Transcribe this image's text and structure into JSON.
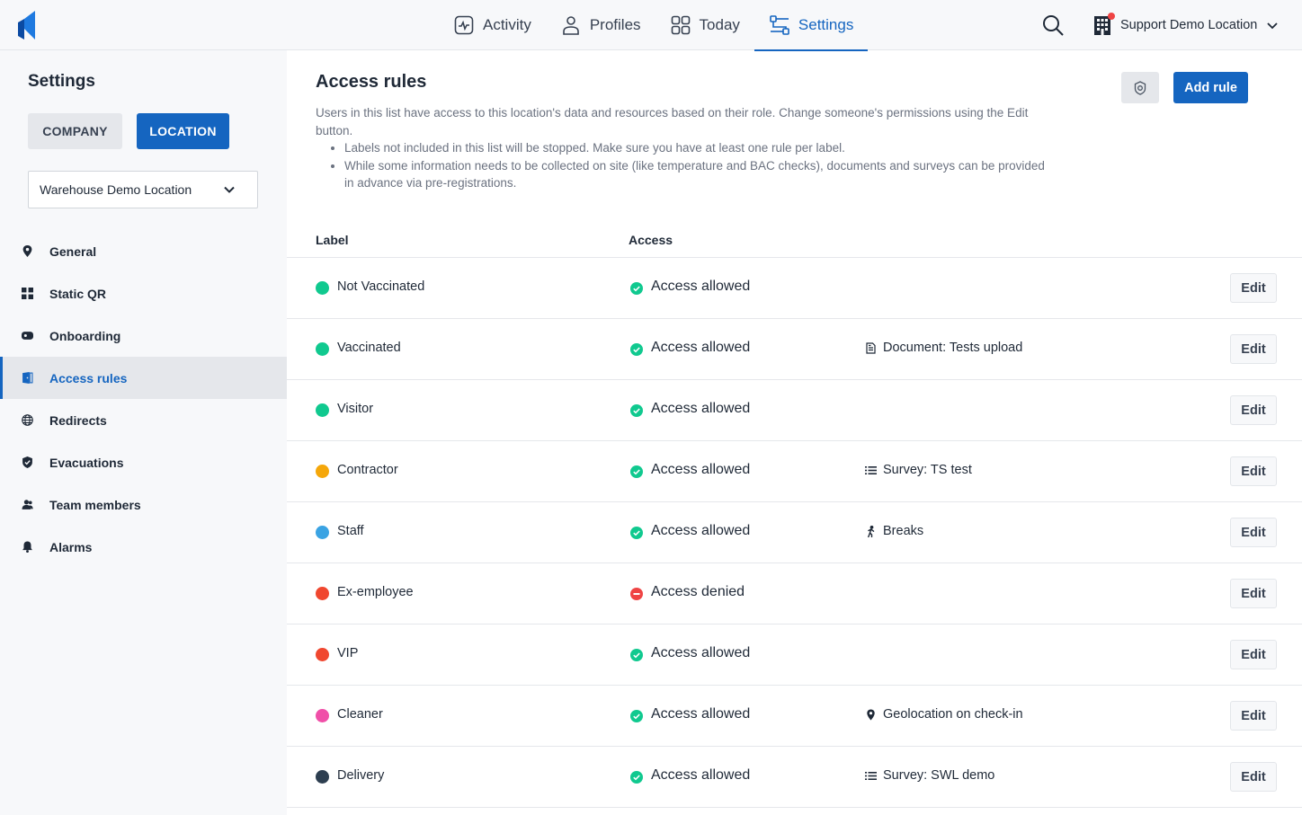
{
  "topbar": {
    "nav": [
      {
        "label": "Activity",
        "icon": "activity-icon",
        "active": false
      },
      {
        "label": "Profiles",
        "icon": "profile-icon",
        "active": false
      },
      {
        "label": "Today",
        "icon": "grid-icon",
        "active": false
      },
      {
        "label": "Settings",
        "icon": "settings-icon",
        "active": true
      }
    ],
    "location_name": "Support Demo Location",
    "accent": "#1565c0"
  },
  "sidebar": {
    "title": "Settings",
    "tabs": {
      "company": "COMPANY",
      "location": "LOCATION",
      "selected": "LOCATION"
    },
    "location_select": "Warehouse Demo Location",
    "items": [
      {
        "label": "General",
        "icon": "pin-icon",
        "active": false
      },
      {
        "label": "Static QR",
        "icon": "qr-icon",
        "active": false
      },
      {
        "label": "Onboarding",
        "icon": "onboarding-icon",
        "active": false
      },
      {
        "label": "Access rules",
        "icon": "door-icon",
        "active": true
      },
      {
        "label": "Redirects",
        "icon": "globe-icon",
        "active": false
      },
      {
        "label": "Evacuations",
        "icon": "shield-icon",
        "active": false
      },
      {
        "label": "Team members",
        "icon": "team-icon",
        "active": false
      },
      {
        "label": "Alarms",
        "icon": "bell-icon",
        "active": false
      }
    ]
  },
  "main": {
    "title": "Access rules",
    "add_button": "Add rule",
    "description": "Users in this list have access to this location's data and resources based on their role. Change someone's permissions using the Edit button.",
    "bullets": [
      "Labels not included in this list will be stopped. Make sure you have at least one rule per label.",
      "While some information needs to be collected on site (like temperature and BAC checks), documents and surveys can be provided in advance via pre-registrations."
    ],
    "columns": {
      "label": "Label",
      "access": "Access"
    },
    "rows": [
      {
        "label": "Not Vaccinated",
        "color": "#10c98f",
        "access": "Access allowed",
        "status": "allowed",
        "requirement": "",
        "req_icon": ""
      },
      {
        "label": "Vaccinated",
        "color": "#10c98f",
        "access": "Access allowed",
        "status": "allowed",
        "requirement": "Document: Tests upload",
        "req_icon": "document-icon"
      },
      {
        "label": "Visitor",
        "color": "#10c98f",
        "access": "Access allowed",
        "status": "allowed",
        "requirement": "",
        "req_icon": ""
      },
      {
        "label": "Contractor",
        "color": "#f5a70a",
        "access": "Access allowed",
        "status": "allowed",
        "requirement": "Survey: TS test",
        "req_icon": "list-icon"
      },
      {
        "label": "Staff",
        "color": "#3aa3e3",
        "access": "Access allowed",
        "status": "allowed",
        "requirement": "Breaks",
        "req_icon": "walk-icon"
      },
      {
        "label": "Ex-employee",
        "color": "#f0472f",
        "access": "Access denied",
        "status": "denied",
        "requirement": "",
        "req_icon": ""
      },
      {
        "label": "VIP",
        "color": "#f0472f",
        "access": "Access allowed",
        "status": "allowed",
        "requirement": "",
        "req_icon": ""
      },
      {
        "label": "Cleaner",
        "color": "#f04fa8",
        "access": "Access allowed",
        "status": "allowed",
        "requirement": "Geolocation on check-in",
        "req_icon": "pin-icon"
      },
      {
        "label": "Delivery",
        "color": "#2d3e50",
        "access": "Access allowed",
        "status": "allowed",
        "requirement": "Survey: SWL demo",
        "req_icon": "list-icon"
      }
    ],
    "edit_label": "Edit",
    "status_colors": {
      "allowed": "#10c98f",
      "denied": "#ef4444"
    }
  }
}
